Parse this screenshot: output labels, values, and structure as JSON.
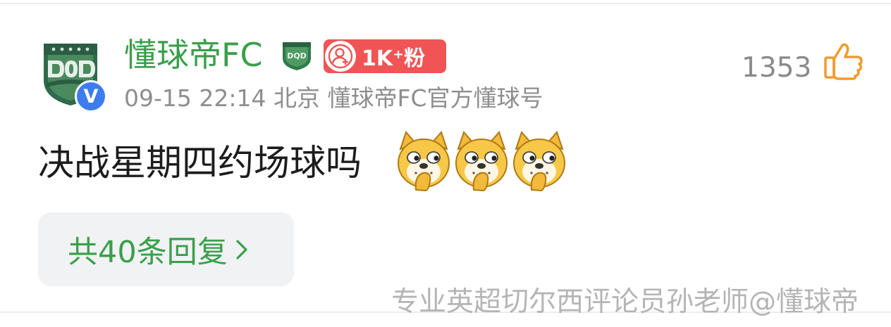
{
  "comment": {
    "user": {
      "name": "懂球帝FC",
      "verified_mark": "V",
      "fans_badge": "1K⁺粉"
    },
    "meta": {
      "date": "09-15",
      "time": "22:14",
      "location": "北京",
      "account_desc": "懂球帝FC官方懂球号"
    },
    "text": "决战星期四约场球吗",
    "emojis": [
      "doge-cover-mouth-emoji",
      "doge-cover-mouth-emoji",
      "doge-cover-mouth-emoji"
    ],
    "likes": "1353",
    "replies_label": "共40条回复"
  },
  "watermark": "专业英超切尔西评论员孙老师@懂球帝",
  "colors": {
    "name_green": "#3a9f4a",
    "meta_gray": "#8e8e8e",
    "fans_red": "#f05455",
    "verified_blue": "#3d7cf0",
    "like_orange": "#f39a2b",
    "reply_bg": "#f1f2f3"
  },
  "icons": {
    "avatar": "dqd-club-logo",
    "team_badge": "dqd-shield-icon",
    "fans": "user-plus-icon",
    "like": "thumbs-up-icon",
    "chevron": "chevron-right-icon"
  }
}
